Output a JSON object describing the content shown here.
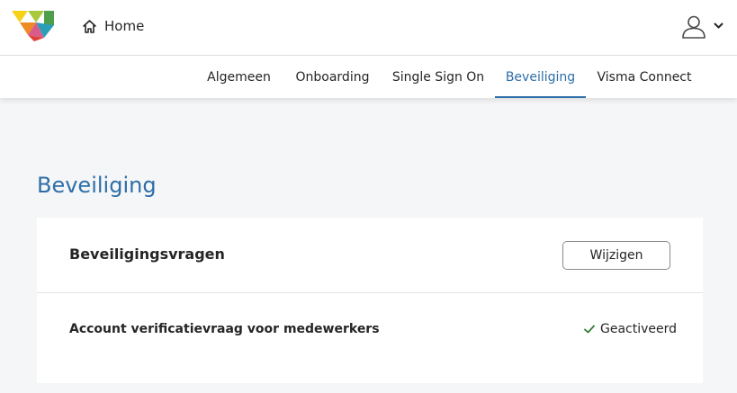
{
  "header": {
    "logo_icon": "visma-logo-icon",
    "home_icon": "home-icon",
    "home_label": "Home",
    "user_icon": "user-icon",
    "user_menu_icon": "chevron-down-icon"
  },
  "tabs": [
    {
      "label": "Algemeen",
      "active": false
    },
    {
      "label": "Onboarding",
      "active": false
    },
    {
      "label": "Single Sign On",
      "active": false
    },
    {
      "label": "Beveiliging",
      "active": true
    },
    {
      "label": "Visma Connect",
      "active": false
    }
  ],
  "page": {
    "title": "Beveiliging"
  },
  "security_card": {
    "title": "Beveiligingsvragen",
    "edit_button_label": "Wijzigen",
    "row_label": "Account verificatievraag voor medewerkers",
    "status_icon": "check-icon",
    "status_text": "Geactiveerd"
  },
  "colors": {
    "accent": "#2d6ea9",
    "success": "#2e7d32",
    "background": "#f5f6f7"
  }
}
